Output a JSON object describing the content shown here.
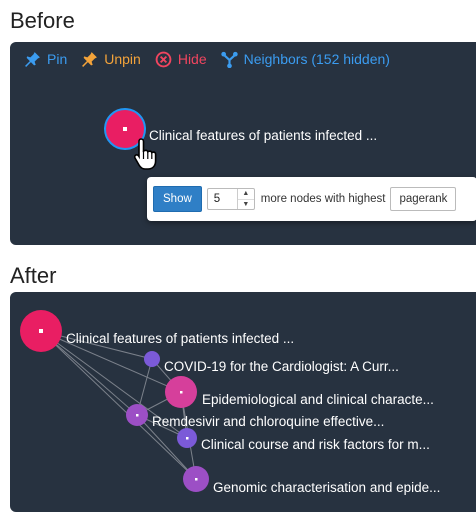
{
  "before": {
    "title": "Before",
    "toolbar": {
      "pin_label": "Pin",
      "unpin_label": "Unpin",
      "hide_label": "Hide",
      "neighbors_label": "Neighbors (152 hidden)",
      "pin_color": "#3b9cf0",
      "unpin_color": "#f3a33a",
      "hide_color": "#f0455f",
      "neighbors_color": "#3b9cf0"
    },
    "node_label": "Clinical features of patients infected ...",
    "node_color": "#e91e63",
    "node_border_color": "#2196f3",
    "popover": {
      "show_label": "Show",
      "count_value": "5",
      "more_text": "more nodes with highest",
      "metric_value": "pagerank"
    }
  },
  "after": {
    "title": "After",
    "node_labels": [
      "Clinical features of patients infected ...",
      "COVID-19 for the Cardiologist: A Curr...",
      "Epidemiological and clinical characte...",
      "Remdesivir and chloroquine effective...",
      "Clinical course and risk factors for m...",
      "Genomic characterisation and epide..."
    ],
    "colors": {
      "primary": "#e91e63",
      "pink": "#d63f9b",
      "purple": "#9c4fc5",
      "blue_purple": "#7b5ad8",
      "edge": "#8a8f98"
    }
  },
  "icons": [
    "pin-icon",
    "unpin-icon",
    "hide-icon",
    "neighbors-icon",
    "cursor-hand-icon"
  ]
}
